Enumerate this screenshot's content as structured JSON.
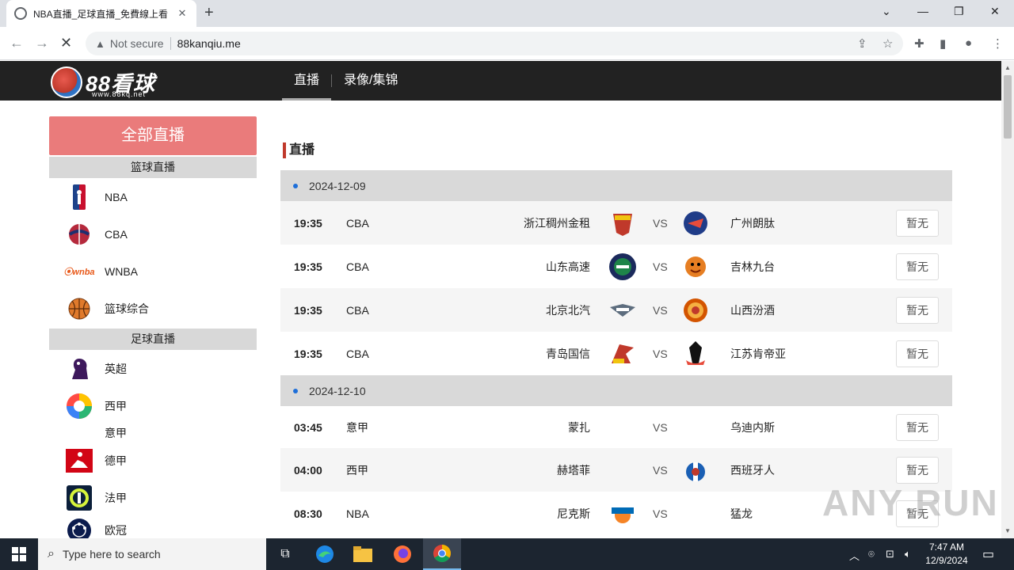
{
  "browser": {
    "tab_title": "NBA直播_足球直播_免費線上看",
    "url_warning": "Not secure",
    "url": "88kanqiu.me"
  },
  "site": {
    "logo_text": "88看球",
    "logo_url": "www.88kq.net",
    "nav": [
      {
        "label": "直播",
        "active": true
      },
      {
        "label": "录像/集锦",
        "active": false
      }
    ]
  },
  "sidebar": {
    "all_live": "全部直播",
    "basketball_head": "篮球直播",
    "basketball_items": [
      {
        "label": "NBA",
        "icon": "nba-logo-icon"
      },
      {
        "label": "CBA",
        "icon": "cba-logo-icon"
      },
      {
        "label": "WNBA",
        "icon": "wnba-logo-icon"
      },
      {
        "label": "篮球综合",
        "icon": "basketball-icon"
      }
    ],
    "football_head": "足球直播",
    "football_items": [
      {
        "label": "英超",
        "icon": "premier-league-icon"
      },
      {
        "label": "西甲",
        "icon": "laliga-icon"
      },
      {
        "label": "意甲",
        "icon": ""
      },
      {
        "label": "德甲",
        "icon": "bundesliga-icon"
      },
      {
        "label": "法甲",
        "icon": "ligue1-icon"
      },
      {
        "label": "欧冠",
        "icon": "champions-league-icon"
      }
    ]
  },
  "main": {
    "title": "直播",
    "days": [
      {
        "date": "2024-12-09",
        "matches": [
          {
            "time": "19:35",
            "league": "CBA",
            "home": "浙江稠州金租",
            "vs": "VS",
            "away": "广州朗肽",
            "button": "暂无"
          },
          {
            "time": "19:35",
            "league": "CBA",
            "home": "山东高速",
            "vs": "VS",
            "away": "吉林九台",
            "button": "暂无"
          },
          {
            "time": "19:35",
            "league": "CBA",
            "home": "北京北汽",
            "vs": "VS",
            "away": "山西汾酒",
            "button": "暂无"
          },
          {
            "time": "19:35",
            "league": "CBA",
            "home": "青岛国信",
            "vs": "VS",
            "away": "江苏肯帝亚",
            "button": "暂无"
          }
        ]
      },
      {
        "date": "2024-12-10",
        "matches": [
          {
            "time": "03:45",
            "league": "意甲",
            "home": "蒙扎",
            "vs": "VS",
            "away": "乌迪内斯",
            "button": "暂无"
          },
          {
            "time": "04:00",
            "league": "西甲",
            "home": "赫塔菲",
            "vs": "VS",
            "away": "西班牙人",
            "button": "暂无"
          },
          {
            "time": "08:30",
            "league": "NBA",
            "home": "尼克斯",
            "vs": "VS",
            "away": "猛龙",
            "button": "暂无"
          }
        ]
      }
    ]
  },
  "watermark": "ANY RUN",
  "taskbar": {
    "search_placeholder": "Type here to search",
    "time": "7:47 AM",
    "date": "12/9/2024"
  },
  "colors": {
    "header_bg": "#222222",
    "all_live_bg": "#ea7b7b",
    "accent": "#c0392b",
    "date_dot": "#1e6fd9"
  }
}
